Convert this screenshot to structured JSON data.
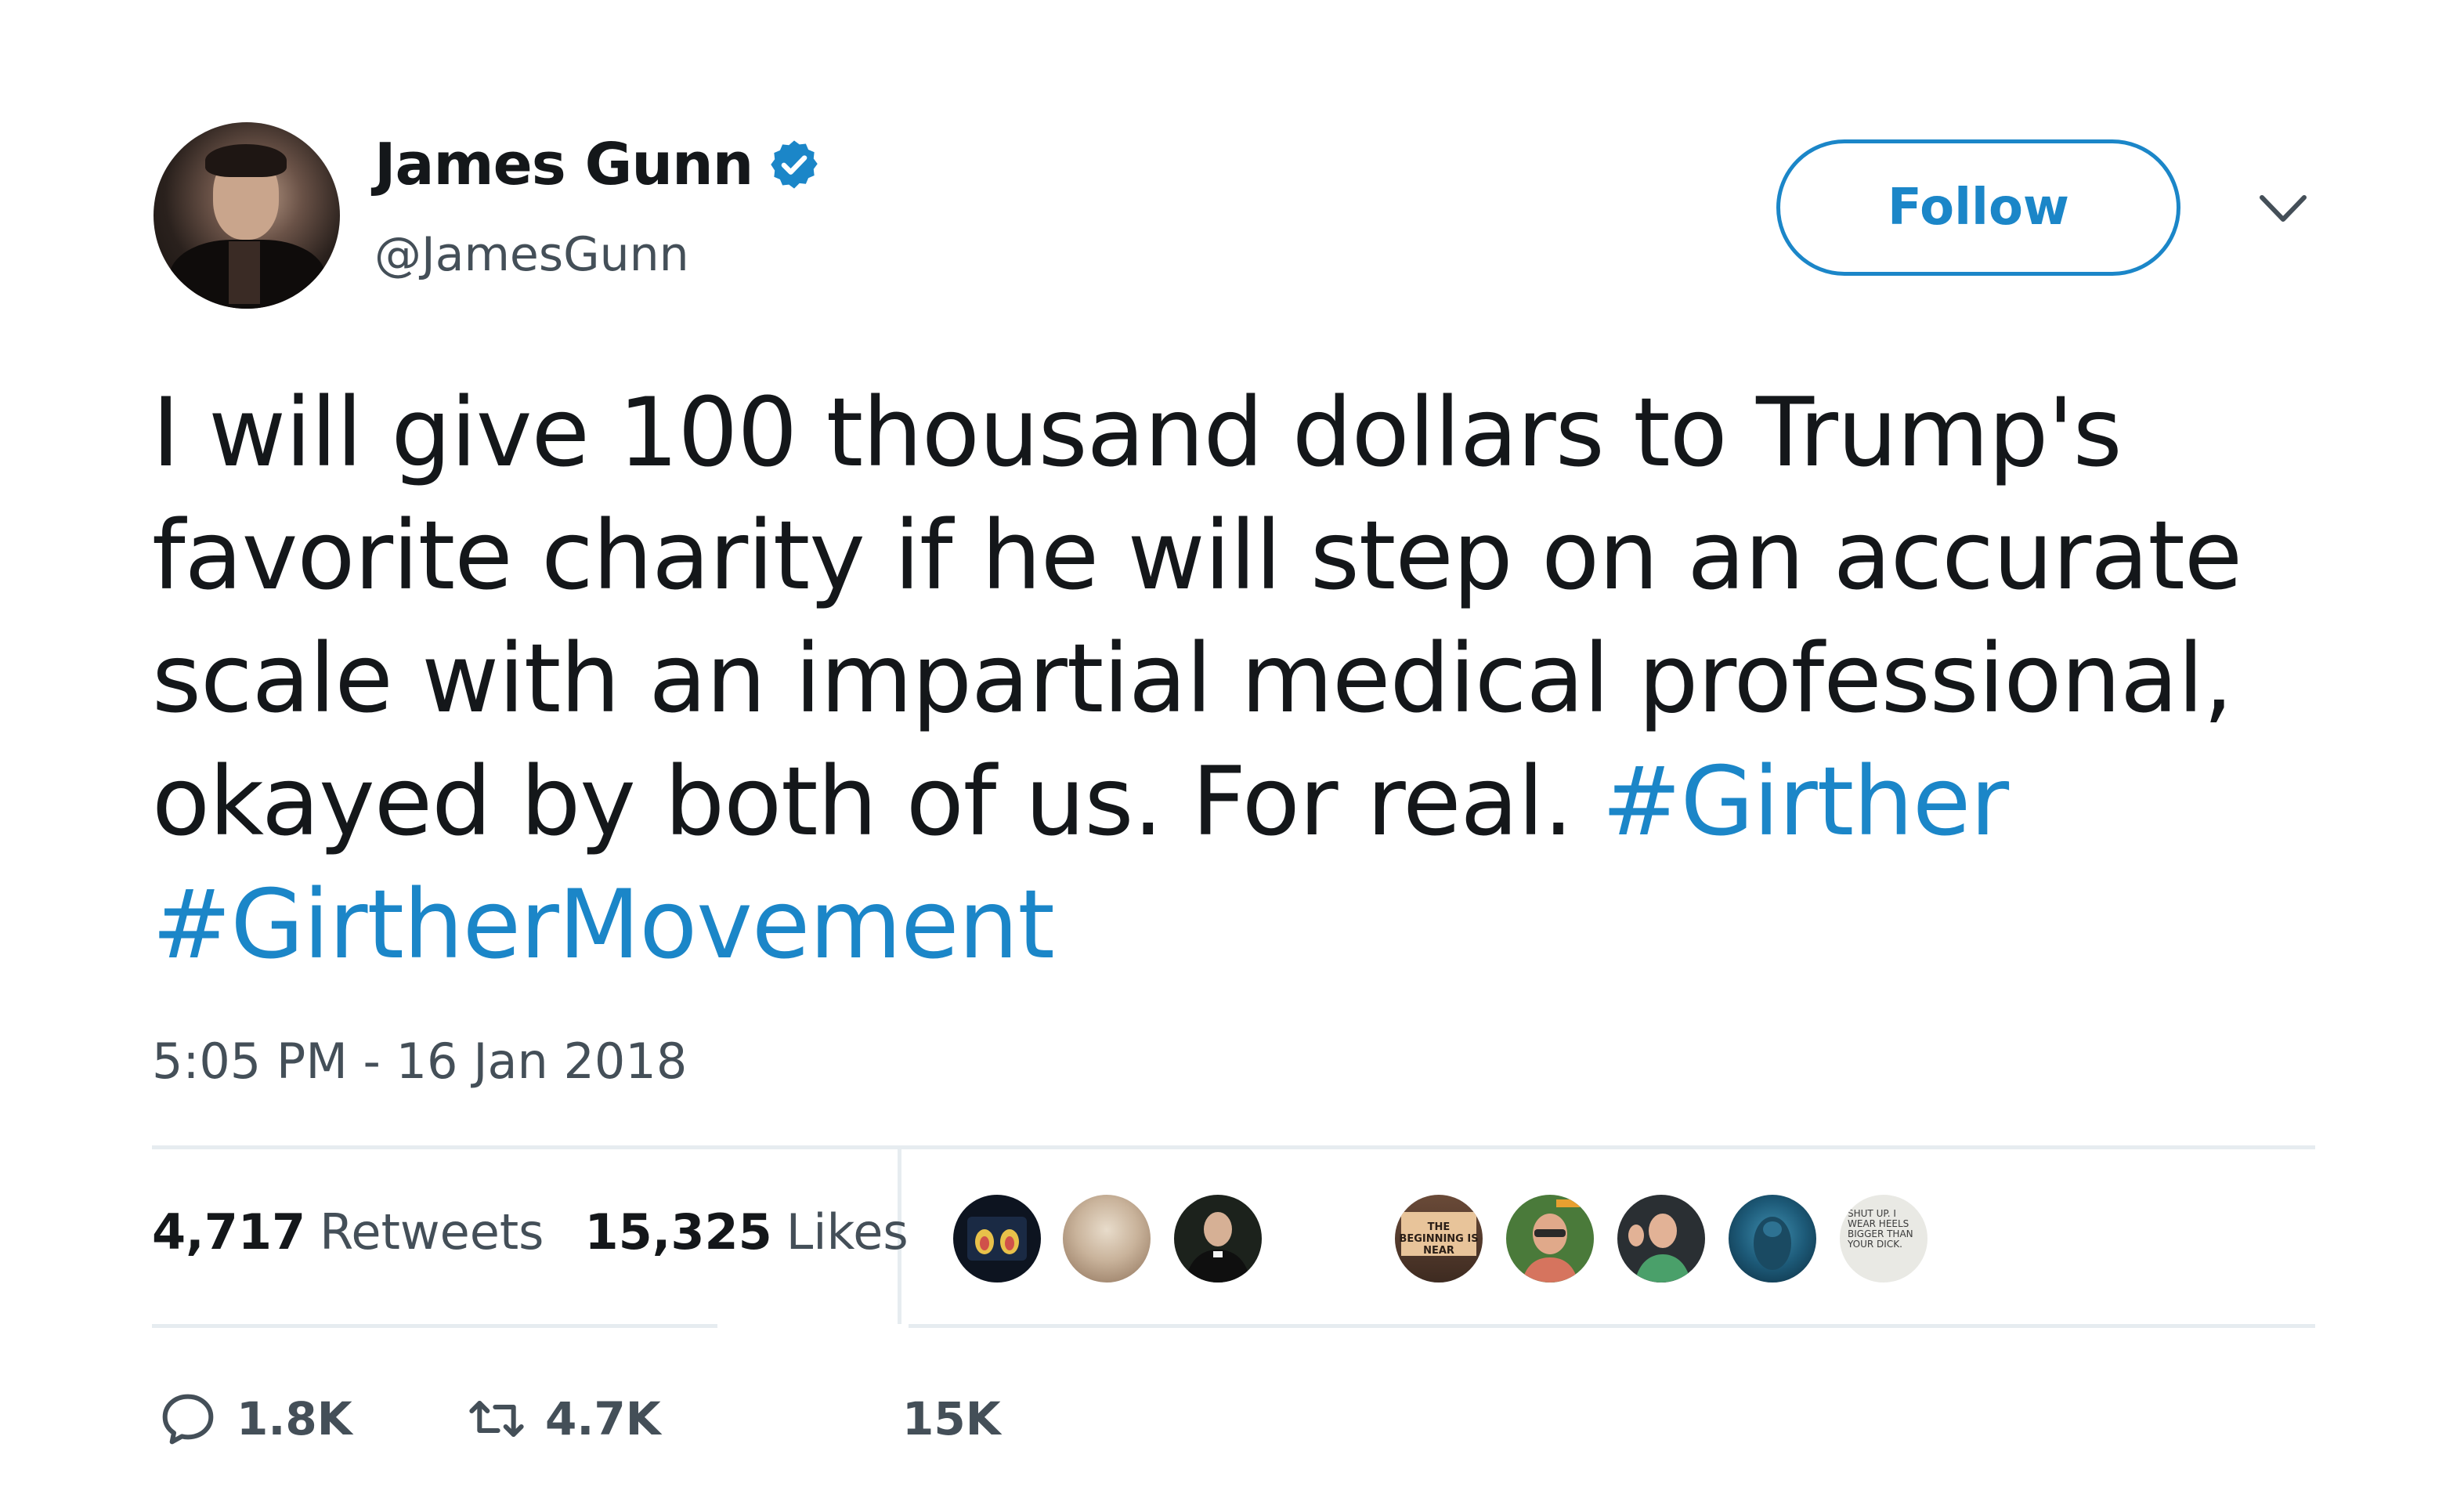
{
  "author": {
    "display_name": "James Gunn",
    "handle": "@JamesGunn",
    "verified": true,
    "avatar_icon": "profile-photo"
  },
  "follow_button": {
    "label": "Follow"
  },
  "menu": {
    "icon": "chevron-down-icon"
  },
  "tweet": {
    "text": "I will give 100 thousand dollars to Trump's favorite charity if he will step on an accurate scale with an impartial medical professional, okayed by both of us. For real.",
    "hashtags": [
      "#Girther",
      "#GirtherMovement"
    ],
    "timestamp": "5:05 PM - 16 Jan 2018"
  },
  "stats": {
    "retweets_count": "4,717",
    "retweets_label": "Retweets",
    "likes_count": "15,325",
    "likes_label": "Likes"
  },
  "liker_avatars": [
    {
      "icon": "hands-image"
    },
    {
      "icon": "photo-avatar"
    },
    {
      "icon": "priest-avatar"
    },
    {
      "icon": "sign-avatar",
      "text": "THE BEGINNING IS NEAR"
    },
    {
      "icon": "man-avatar"
    },
    {
      "icon": "waving-man-avatar"
    },
    {
      "icon": "creature-avatar"
    },
    {
      "icon": "text-avatar",
      "text": "SHUT UP. I WEAR HEELS BIGGER THAN YOUR DICK."
    }
  ],
  "actions": {
    "reply_count": "1.8K",
    "retweet_count": "4.7K",
    "like_count": "15K"
  },
  "colors": {
    "link": "#1b86c8",
    "text": "#14171a",
    "secondary": "#444f58",
    "divider": "#e6ecf0"
  }
}
